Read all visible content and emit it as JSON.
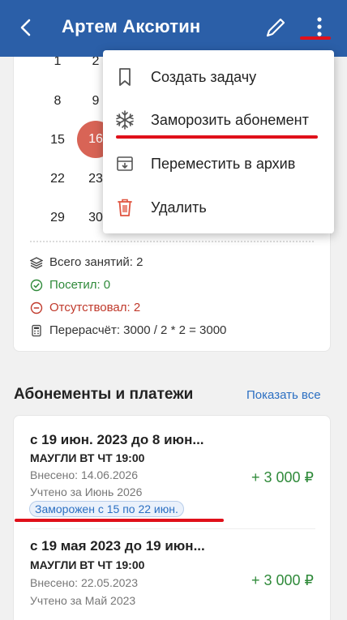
{
  "header": {
    "title": "Артем Аксютин",
    "colors": {
      "background": "#2b5fa8",
      "text": "#ffffff",
      "annotation": "#e0101a"
    }
  },
  "calendar": {
    "rows": [
      [
        "1",
        "2"
      ],
      [
        "8",
        "9"
      ],
      [
        "15",
        "16"
      ],
      [
        "22",
        "23"
      ],
      [
        "29",
        "30"
      ]
    ],
    "today": "16"
  },
  "stats": {
    "total": "Всего занятий: 2",
    "visited": "Посетил: 0",
    "absent": "Отсутствовал: 2",
    "recalc": "Перерасчёт: 3000 / 2 * 2 = 3000"
  },
  "subscriptions": {
    "title": "Абонементы и платежи",
    "show_all": "Показать все",
    "items": [
      {
        "period": "с 19 июн. 2023 до 8 июн...",
        "group": "МАУГЛИ ВТ ЧТ 19:00",
        "paid": "Внесено: 14.06.2026",
        "counted": "Учтено за Июнь 2026",
        "amount": "+ 3 000 ₽",
        "frozen": "Заморожен с 15 по 22 июн."
      },
      {
        "period": "с 19 мая 2023 до 19 июн...",
        "group": "МАУГЛИ ВТ ЧТ 19:00",
        "paid": "Внесено: 22.05.2023",
        "counted": "Учтено за Май 2023",
        "amount": "+ 3 000 ₽"
      }
    ]
  },
  "menu": {
    "items": [
      {
        "label": "Создать задачу",
        "icon": "bookmark-icon"
      },
      {
        "label": "Заморозить абонемент",
        "icon": "snowflake-icon"
      },
      {
        "label": "Переместить в архив",
        "icon": "archive-icon"
      },
      {
        "label": "Удалить",
        "icon": "trash-icon"
      }
    ]
  }
}
